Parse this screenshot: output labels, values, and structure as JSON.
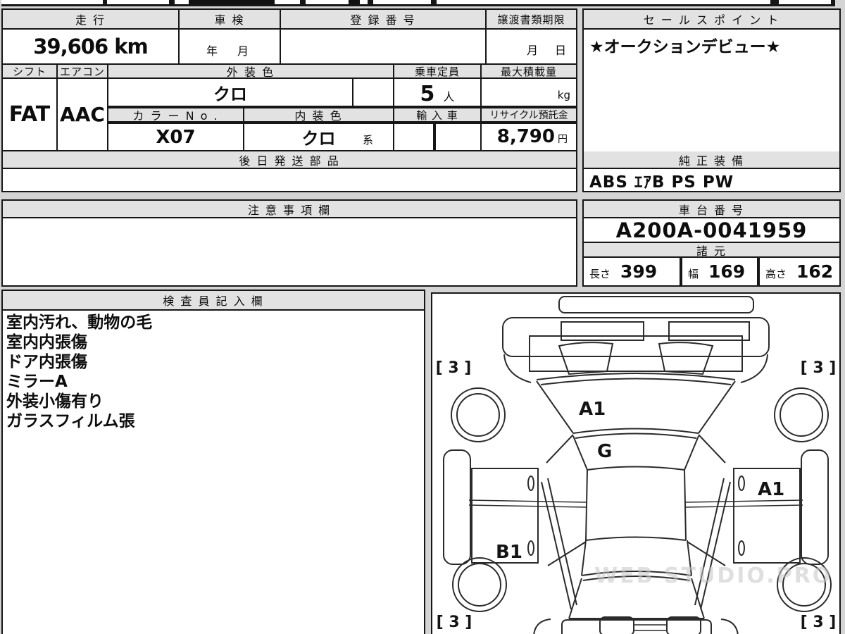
{
  "colors": {
    "page_bg": "#d4d4d4",
    "header_bg": "#e2e2e2",
    "cell_bg": "#ffffff",
    "border": "#161616",
    "ink": "#0d0d0d",
    "diagram_line": "#2b2b2b",
    "watermark_color": "#c6c6c6"
  },
  "info": {
    "mileage_label": "走 行",
    "mileage_value": "39,606 km",
    "inspection_label": "車 検",
    "inspection_value": "年　月",
    "registration_label": "登 録 番 号",
    "registration_value": "",
    "transfer_docs_label": "譲渡書類期限",
    "transfer_docs_value": "月　日",
    "shift_label": "シフト",
    "shift_value": "FAT",
    "aircon_label": "エアコン",
    "aircon_value": "AAC",
    "exterior_color_label": "外 装 色",
    "exterior_color_value": "クロ",
    "capacity_label": "乗車定員",
    "capacity_value": "5",
    "capacity_unit": "人",
    "max_load_label": "最大積載量",
    "max_load_value": "",
    "max_load_unit": "kg",
    "color_no_label": "カ ラ ー N o .",
    "color_no_value": "X07",
    "interior_color_label": "内 装 色",
    "interior_color_value": "クロ",
    "interior_color_suffix": "系",
    "import_label": "輸 入 車",
    "import_value": "",
    "recycle_label": "リサイクル預託金",
    "recycle_value": "8,790",
    "recycle_unit": "円",
    "later_parts_label": "後 日 発 送 部 品",
    "later_parts_value": ""
  },
  "sales_point": {
    "label": "セ ー ル ス ポ イ ン ト",
    "value": "★オークションデビュー★"
  },
  "equipment": {
    "label": "純 正 装 備",
    "value": "ABS ｴｱB PS PW"
  },
  "caution": {
    "label": "注 意 事 項 欄",
    "value": ""
  },
  "chassis": {
    "label": "車 台 番 号",
    "value": "A200A-0041959"
  },
  "specs": {
    "label": "諸 元",
    "length_label": "長さ",
    "length_value": "399",
    "width_label": "幅",
    "width_value": "169",
    "height_label": "高さ",
    "height_value": "162"
  },
  "inspector": {
    "label": "検 査 員 記 入 欄",
    "lines": [
      "室内汚れ、動物の毛",
      "室内内張傷",
      "ドア内張傷",
      "ミラーA",
      "外装小傷有り",
      "ガラスフィルム張"
    ]
  },
  "diagram": {
    "tire_front_left": "[ 3 ]",
    "tire_front_right": "[ 3 ]",
    "tire_rear_left": "[ 3 ]",
    "tire_rear_right": "[ 3 ]",
    "mark_hood": "A1",
    "mark_windshield": "G",
    "mark_right_door": "A1",
    "mark_left_rear_door": "B1",
    "watermark": "WEB STUDIO.PRO"
  }
}
